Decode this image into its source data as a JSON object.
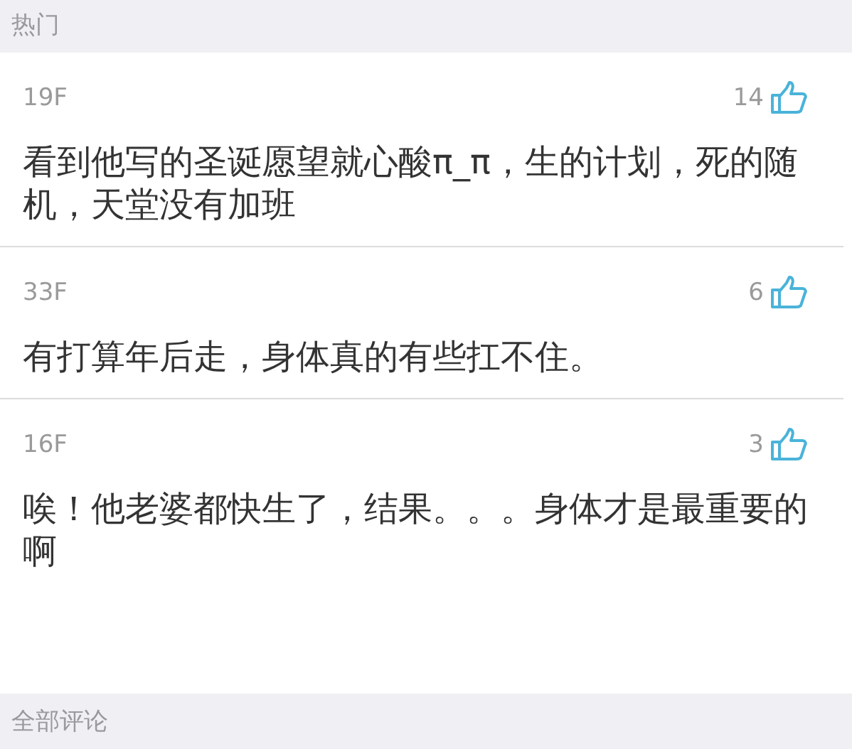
{
  "section_header": "热门",
  "comments": [
    {
      "floor": "19F",
      "likes": "14",
      "text": "看到他写的圣诞愿望就心酸π_π，生的计划，死的随机，天堂没有加班"
    },
    {
      "floor": "33F",
      "likes": "6",
      "text": "有打算年后走，身体真的有些扛不住。"
    },
    {
      "floor": "16F",
      "likes": "3",
      "text": "唉！他老婆都快生了，结果。。。身体才是最重要的啊"
    }
  ],
  "footer_header": "全部评论"
}
